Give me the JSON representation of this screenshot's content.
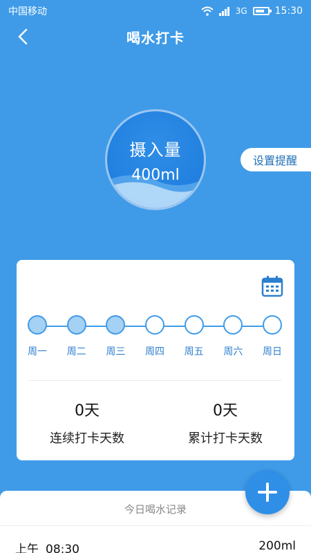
{
  "status_bar": {
    "carrier": "中国移动",
    "network": "3G",
    "time": "15:30"
  },
  "nav": {
    "title": "喝水打卡",
    "back_icon": "chevron-left-icon"
  },
  "intake": {
    "label": "摄入量",
    "value": "400ml"
  },
  "reminder": {
    "label": "设置提醒"
  },
  "week": [
    {
      "label": "周一",
      "checked": true
    },
    {
      "label": "周二",
      "checked": true
    },
    {
      "label": "周三",
      "checked": true
    },
    {
      "label": "周四",
      "checked": false
    },
    {
      "label": "周五",
      "checked": false
    },
    {
      "label": "周六",
      "checked": false
    },
    {
      "label": "周日",
      "checked": false
    }
  ],
  "stats": {
    "consecutive": {
      "value": "0天",
      "label": "连续打卡天数"
    },
    "total": {
      "value": "0天",
      "label": "累计打卡天数"
    }
  },
  "records": {
    "title": "今日喝水记录",
    "items": [
      {
        "period": "上午",
        "time": "08:30",
        "amount": "200ml"
      }
    ]
  },
  "colors": {
    "primary": "#3f9be8",
    "circle": "#1b79dc",
    "accent_text": "#2d7fcf"
  }
}
